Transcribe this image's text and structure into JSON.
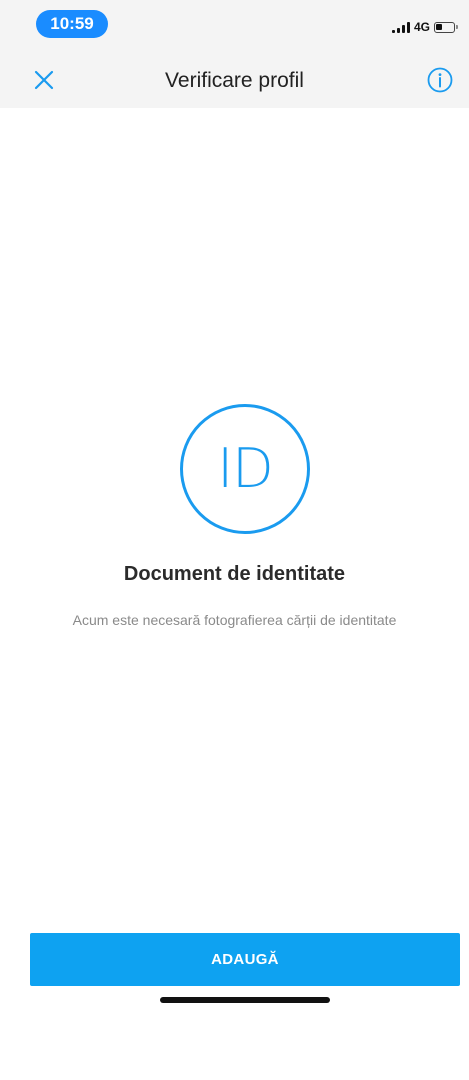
{
  "status_bar": {
    "time": "10:59",
    "network": "4G",
    "icons": [
      "signal-icon",
      "battery-icon"
    ]
  },
  "nav": {
    "title": "Verificare profil",
    "close_icon": "close-icon",
    "info_icon": "info-icon"
  },
  "content": {
    "badge_text": "ID",
    "title": "Document de identitate",
    "subtitle": "Acum este necesară fotografierea cărții de identitate"
  },
  "actions": {
    "add_label": "ADAUGĂ"
  },
  "colors": {
    "accent": "#1a9bef",
    "button": "#0ea2f1",
    "time_pill": "#1a8cff",
    "header_bg": "#f4f4f4"
  }
}
